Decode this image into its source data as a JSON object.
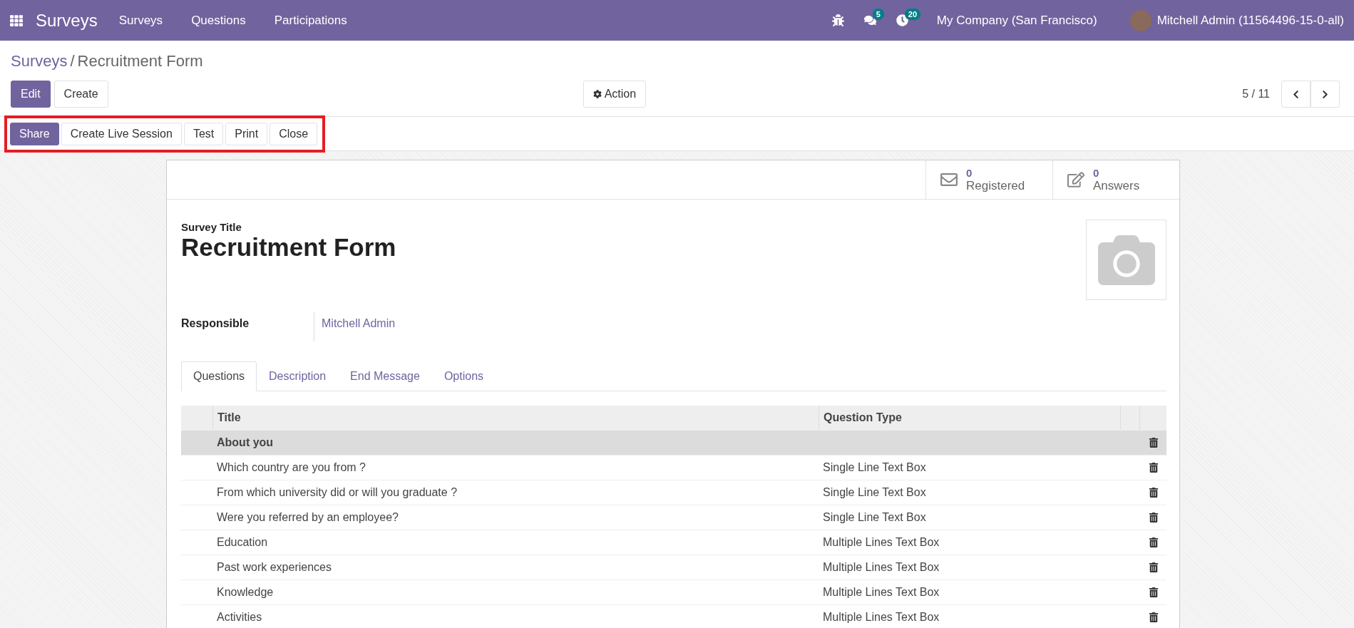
{
  "topbar": {
    "app_name": "Surveys",
    "menu": [
      "Surveys",
      "Questions",
      "Participations"
    ],
    "chat_count": "5",
    "activity_count": "20",
    "company": "My Company (San Francisco)",
    "user": "Mitchell Admin (11564496-15-0-all)"
  },
  "breadcrumb": {
    "parent": "Surveys",
    "separator": "/",
    "current": "Recruitment Form"
  },
  "control_buttons": [
    {
      "label": "Edit",
      "primary": true
    },
    {
      "label": "Create",
      "primary": false
    }
  ],
  "action": "Action",
  "pager": "5 / 11",
  "status_bar": {
    "highlighted": true,
    "buttons": [
      {
        "label": "Share",
        "primary": true
      },
      {
        "label": "Create Live Session",
        "primary": false
      },
      {
        "label": "Test",
        "primary": false
      },
      {
        "label": "Print",
        "primary": false
      },
      {
        "label": "Close",
        "primary": false
      }
    ]
  },
  "stats": [
    {
      "kind": "mail",
      "value": "0",
      "label": "Registered"
    },
    {
      "kind": "edit",
      "value": "0",
      "label": "Answers"
    }
  ],
  "form": {
    "title_label": "Survey Title",
    "title": "Recruitment Form",
    "responsible_label": "Responsible",
    "responsible": "Mitchell Admin"
  },
  "tabs": [
    {
      "label": "Questions",
      "selected": true
    },
    {
      "label": "Description",
      "selected": false
    },
    {
      "label": "End Message",
      "selected": false
    },
    {
      "label": "Options",
      "selected": false
    }
  ],
  "table": {
    "columns": [
      "Title",
      "Question Type"
    ],
    "rows": [
      {
        "kind": "section",
        "title": "About you"
      },
      {
        "kind": "question",
        "title": "Which country are you from ?",
        "type": "Single Line Text Box"
      },
      {
        "kind": "question",
        "title": "From which university did or will you graduate ?",
        "type": "Single Line Text Box"
      },
      {
        "kind": "question",
        "title": "Were you referred by an employee?",
        "type": "Single Line Text Box"
      },
      {
        "kind": "question",
        "title": "Education",
        "type": "Multiple Lines Text Box"
      },
      {
        "kind": "question",
        "title": "Past work experiences",
        "type": "Multiple Lines Text Box"
      },
      {
        "kind": "question",
        "title": "Knowledge",
        "type": "Multiple Lines Text Box"
      },
      {
        "kind": "question",
        "title": "Activities",
        "type": "Multiple Lines Text Box"
      }
    ]
  }
}
